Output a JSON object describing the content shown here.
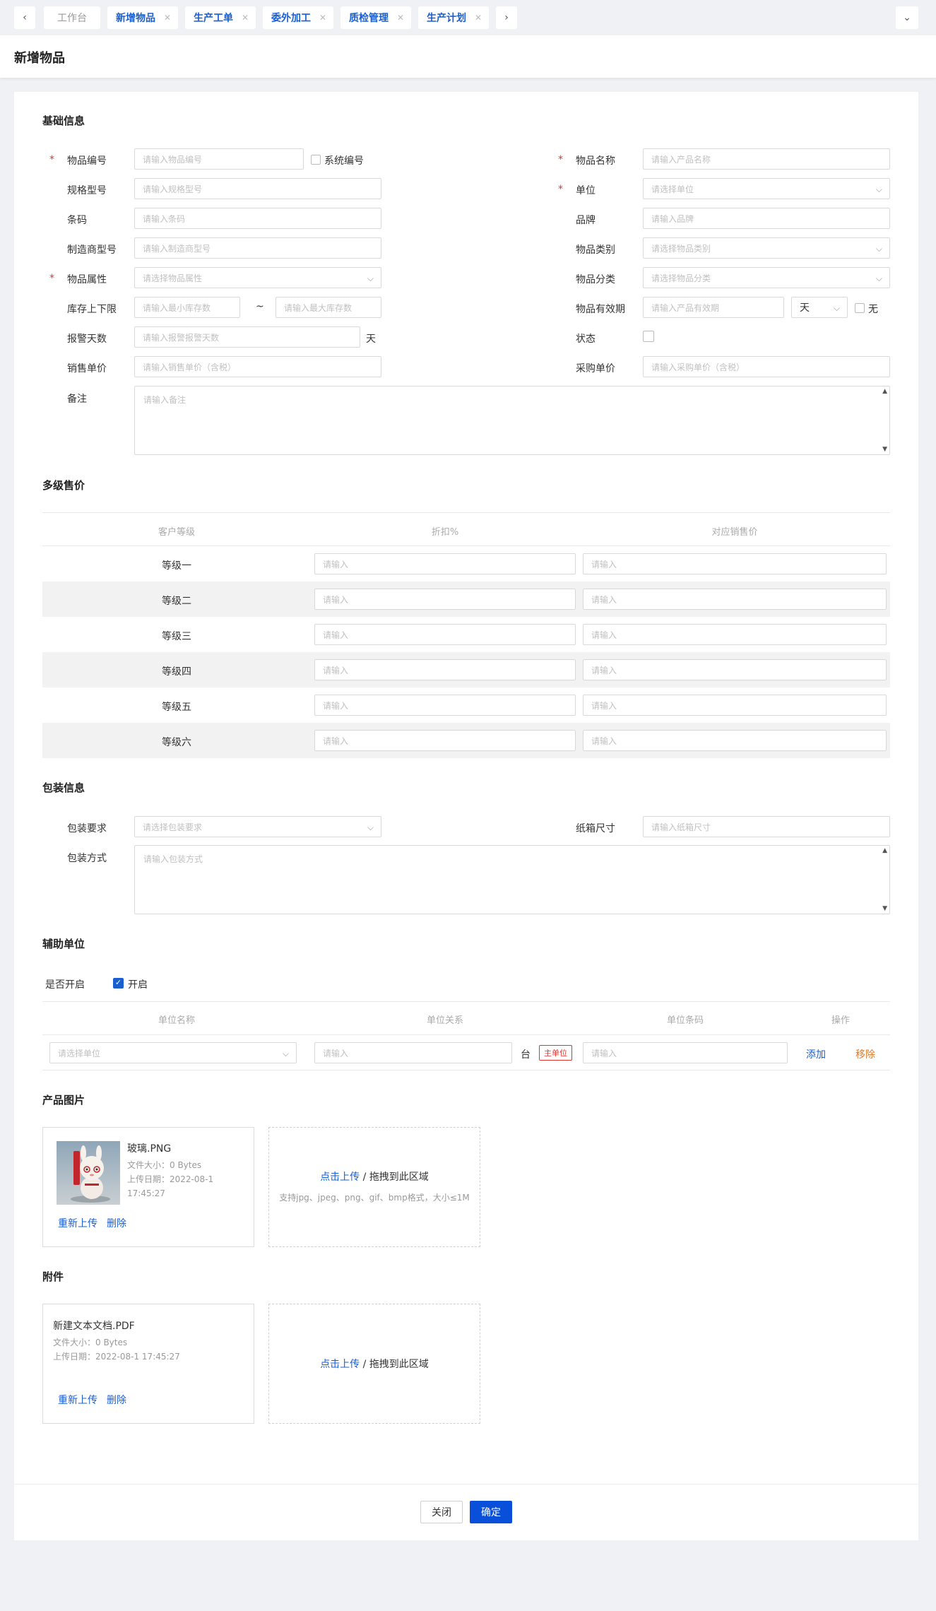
{
  "tabs": [
    {
      "label": "工作台",
      "closable": false
    },
    {
      "label": "新增物品",
      "closable": true
    },
    {
      "label": "生产工单",
      "closable": true
    },
    {
      "label": "委外加工",
      "closable": true
    },
    {
      "label": "质检管理",
      "closable": true
    },
    {
      "label": "生产计划",
      "closable": true
    }
  ],
  "page_title": "新增物品",
  "sections": {
    "basic": "基础信息",
    "multi_price": "多级售价",
    "package": "包装信息",
    "aux_unit": "辅助单位",
    "images": "产品图片",
    "attachments": "附件"
  },
  "basic": {
    "item_code": {
      "label": "物品编号",
      "placeholder": "请输入物品编号",
      "checkbox_label": "系统编号"
    },
    "item_name": {
      "label": "物品名称",
      "placeholder": "请输入产品名称"
    },
    "spec": {
      "label": "规格型号",
      "placeholder": "请输入规格型号"
    },
    "unit": {
      "label": "单位",
      "placeholder": "请选择单位"
    },
    "barcode": {
      "label": "条码",
      "placeholder": "请输入条码"
    },
    "brand": {
      "label": "品牌",
      "placeholder": "请输入品牌"
    },
    "mfr_model": {
      "label": "制造商型号",
      "placeholder": "请输入制造商型号"
    },
    "category": {
      "label": "物品类别",
      "placeholder": "请选择物品类别"
    },
    "attribute": {
      "label": "物品属性",
      "placeholder": "请选择物品属性"
    },
    "classification": {
      "label": "物品分类",
      "placeholder": "请选择物品分类"
    },
    "stock_limit": {
      "label": "库存上下限",
      "min_placeholder": "请输入最小库存数",
      "separator": "~",
      "max_placeholder": "请输入最大库存数"
    },
    "validity": {
      "label": "物品有效期",
      "placeholder": "请输入产品有效期",
      "unit_value": "天",
      "none_label": "无"
    },
    "alarm_days": {
      "label": "报警天数",
      "placeholder": "请输入报警报警天数",
      "suffix": "天"
    },
    "status": {
      "label": "状态"
    },
    "sale_price": {
      "label": "销售单价",
      "placeholder": "请输入销售单价（含税）"
    },
    "purchase_price": {
      "label": "采购单价",
      "placeholder": "请输入采购单价（含税）"
    },
    "remark": {
      "label": "备注",
      "placeholder": "请输入备注"
    }
  },
  "multi_price": {
    "columns": [
      "客户等级",
      "折扣%",
      "对应销售价"
    ],
    "input_placeholder": "请输入",
    "levels": [
      "等级一",
      "等级二",
      "等级三",
      "等级四",
      "等级五",
      "等级六"
    ]
  },
  "package": {
    "requirement": {
      "label": "包装要求",
      "placeholder": "请选择包装要求"
    },
    "carton_size": {
      "label": "纸箱尺寸",
      "placeholder": "请输入纸箱尺寸"
    },
    "method": {
      "label": "包装方式",
      "placeholder": "请输入包装方式"
    }
  },
  "aux_unit": {
    "enable_label": "是否开启",
    "enable_checkbox": "开启",
    "columns": [
      "单位名称",
      "单位关系",
      "单位条码",
      "操作"
    ],
    "unit_placeholder": "请选择单位",
    "relation_placeholder": "请输入",
    "relation_unit": "台",
    "main_unit_tag": "主单位",
    "barcode_placeholder": "请输入",
    "add": "添加",
    "remove": "移除"
  },
  "images": {
    "file": {
      "name": "玻璃.PNG",
      "size": "文件大小：0 Bytes",
      "date_line1": "上传日期：2022-08-1",
      "date_line2": "17:45:27"
    },
    "reupload": "重新上传",
    "delete": "删除",
    "upload_click": "点击上传",
    "upload_sep": "/",
    "upload_drag": "拖拽到此区域",
    "upload_hint": "支持jpg、jpeg、png、gif、bmp格式，大小≤1M"
  },
  "attachments": {
    "file": {
      "name": "新建文本文档.PDF",
      "size": "文件大小：0 Bytes",
      "date": "上传日期：2022-08-1 17:45:27"
    },
    "reupload": "重新上传",
    "delete": "删除",
    "upload_click": "点击上传",
    "upload_sep": "/",
    "upload_drag": "拖拽到此区域"
  },
  "footer": {
    "close": "关闭",
    "confirm": "确定"
  },
  "colors": {
    "primary": "#0a4fd9",
    "link": "#1a5fd0",
    "required": "#e0342f",
    "warn": "#e07b2c"
  }
}
